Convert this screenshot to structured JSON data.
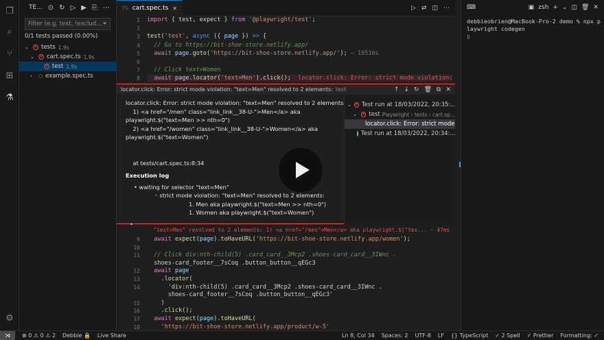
{
  "sidebar": {
    "title": "TE...",
    "filter_placeholder": "Filter (e.g. text, !exclud...",
    "passed": "0/1 tests passed (0.00%)",
    "tree": [
      {
        "label": "tests",
        "time": "1.9s"
      },
      {
        "label": "cart.spec.ts",
        "time": "1.9s"
      },
      {
        "label": "test",
        "time": "1.9s"
      },
      {
        "label": "example.spec.ts",
        "time": ""
      }
    ]
  },
  "editor": {
    "tab": "cart.spec.ts",
    "lines_top": [
      {
        "n": "1",
        "code": "import { test, expect } from '@playwright/test';"
      },
      {
        "n": "2",
        "code": ""
      },
      {
        "n": "3",
        "code": "test('test', async ({ page }) => {"
      },
      {
        "n": "4",
        "code": "  // Go to https://bit-shoe-store.netlify.app/"
      },
      {
        "n": "5",
        "code": "  await page.goto('https://bit-shoe-store.netlify.app/');",
        "dim": " — 1051ms"
      },
      {
        "n": "6",
        "code": ""
      },
      {
        "n": "7",
        "code": "  // Click text=Women"
      },
      {
        "n": "8",
        "code": "  await page.locator('text=Men').click();",
        "err": "  locator.click: Error: strict mode violation:"
      }
    ],
    "peek_title": "locator.click: Error: strict mode violation: \"text=Men\" resolved to 2 elements:",
    "peek_sub": "test",
    "peek_lines": [
      "locator.click: Error: strict mode violation: \"text=Men\" resolved to 2 elements:",
      "    1) <a href=\"/men\" class=\"link_link__38-U-\">Men</a> aka",
      "playwright.$(\"text=Men >> nth=0\")",
      "    2) <a href=\"/women\" class=\"link_link__38-U-\">Women</a> aka",
      "playwright.$(\"text=Women\")",
      "",
      "",
      "    at tests/cart.spec.ts:8:34"
    ],
    "exec_log_title": "Execution log",
    "exec_log": [
      "waiting for selector \"text=Men\"",
      "strict mode violation: \"text=Men\" resolved to 2 elements:",
      "1. Men aka playwright.$(\"text=Men >> nth=0\")",
      "1. Women aka playwright.$(\"text=Women\")"
    ],
    "peek_tree": [
      {
        "label": "Test run at 18/03/2022, 20:35:...",
        "type": "err"
      },
      {
        "label": "test",
        "dim": "Playwright › tests › cart.sp...",
        "type": "err"
      },
      {
        "label": "locator.click: Error: strict mode...",
        "type": "sel"
      },
      {
        "label": "Test run at 18/03/2022, 20:34:...",
        "type": "ok"
      }
    ],
    "err_line": "  \"text=Men\" resolved to 2 elements: 1) <a href=\"/men\">Men</a> aka playwright.$(\"tex... — 47ms",
    "lines_bottom": [
      {
        "n": "9",
        "code": "  await expect(page).toHaveURL('https://bit-shoe-store.netlify.app/women');"
      },
      {
        "n": "10",
        "code": ""
      },
      {
        "n": "11",
        "code": "  // Click div:nth-child(5) .card_card__3Mcp2 .shoes-card_card__3IWnc ."
      },
      {
        "n": "",
        "code": "  shoes-card_footer__7sCoq .button_button__qEGc3"
      },
      {
        "n": "12",
        "code": "  await page"
      },
      {
        "n": "13",
        "code": "    .locator("
      },
      {
        "n": "14",
        "code": "      'div:nth-child(5) .card_card__3Mcp2 .shoes-card_card__3IWnc ."
      },
      {
        "n": "",
        "code": "      shoes-card_footer__7sCoq .button_button__qEGc3'"
      },
      {
        "n": "15",
        "code": "    )"
      },
      {
        "n": "16",
        "code": "    .click();"
      },
      {
        "n": "17",
        "code": "  await expect(page).toHaveURL("
      },
      {
        "n": "18",
        "code": "    'https://bit-shoe-store.netlify.app/product/w-5'"
      }
    ]
  },
  "terminal": {
    "shell": "zsh",
    "text": "debbieobrien@MacBook-Pro-2 demo % npx p\nlaywright codegen\n▯"
  },
  "status": {
    "problems": "⊗ 0 ⚠ 0 ⚠ 2",
    "user": "Debbie 🔒",
    "live": "Live Share",
    "right": [
      "Ln 8, Col 34",
      "Spaces: 2",
      "UTF-8",
      "LF",
      "{} TypeScript",
      "✓ 2 Spell",
      "✓ Prettier",
      "Formatting: ✓"
    ]
  },
  "colors": {
    "error": "#f14c4c",
    "accent": "#0078d4",
    "pass": "#73c991"
  }
}
